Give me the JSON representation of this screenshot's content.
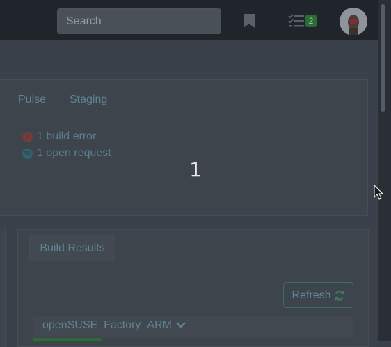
{
  "header": {
    "search_placeholder": "Search",
    "tasks_badge": "2",
    "icons": [
      "bookmark-icon",
      "tasks-icon",
      "avatar"
    ]
  },
  "project": {
    "tabs": [
      "Pulse",
      "Staging"
    ],
    "status": [
      {
        "icon": "error-icon",
        "text": "1 build error"
      },
      {
        "icon": "request-icon",
        "text": "1 open request"
      }
    ]
  },
  "overlay": {
    "number": "1"
  },
  "build_results": {
    "tab_label": "Build Results",
    "refresh_label": "Refresh",
    "repository": "openSUSE_Factory_ARM"
  },
  "colors": {
    "navbar": "#1f252b",
    "link": "#5e8391",
    "error": "#7b3a3a",
    "success": "#2d6b35"
  }
}
